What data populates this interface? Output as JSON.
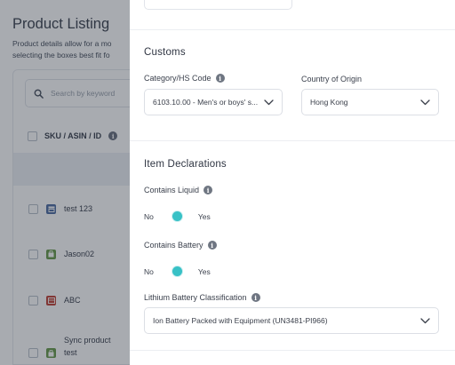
{
  "background_page": {
    "title": "Product Listing",
    "description_line1": "Product details allow for a mo",
    "description_line2": "selecting the boxes best fit fo",
    "search_placeholder": "Search by keyword",
    "column_header": "SKU / ASIN / ID",
    "rows": [
      {
        "label": "test 123",
        "icon": "store-icon",
        "icon_color": "#4f6fa3"
      },
      {
        "label": "Jason02",
        "icon": "bag-icon",
        "icon_color": "#6a9b4c"
      },
      {
        "label": "ABC",
        "icon": "shop-icon",
        "icon_color": "#c0453b"
      },
      {
        "label_line1": "Sync product",
        "label_line2": "test",
        "icon": "bag-icon",
        "icon_color": "#6a9b4c"
      }
    ]
  },
  "customs": {
    "title": "Customs",
    "category_label": "Category/HS Code",
    "category_value": "6103.10.00 - Men's or boys' s...",
    "origin_label": "Country of Origin",
    "origin_value": "Hong Kong"
  },
  "item_declarations": {
    "title": "Item Declarations",
    "liquid_label": "Contains Liquid",
    "liquid_off": "No",
    "liquid_on": "Yes",
    "battery_label": "Contains Battery",
    "battery_off": "No",
    "battery_on": "Yes",
    "lithium_label": "Lithium Battery Classification",
    "lithium_value": "Ion Battery Packed with Equipment (UN3481-PI966)"
  },
  "colors": {
    "accent": "#38c1c6",
    "overlay": "#192130"
  }
}
